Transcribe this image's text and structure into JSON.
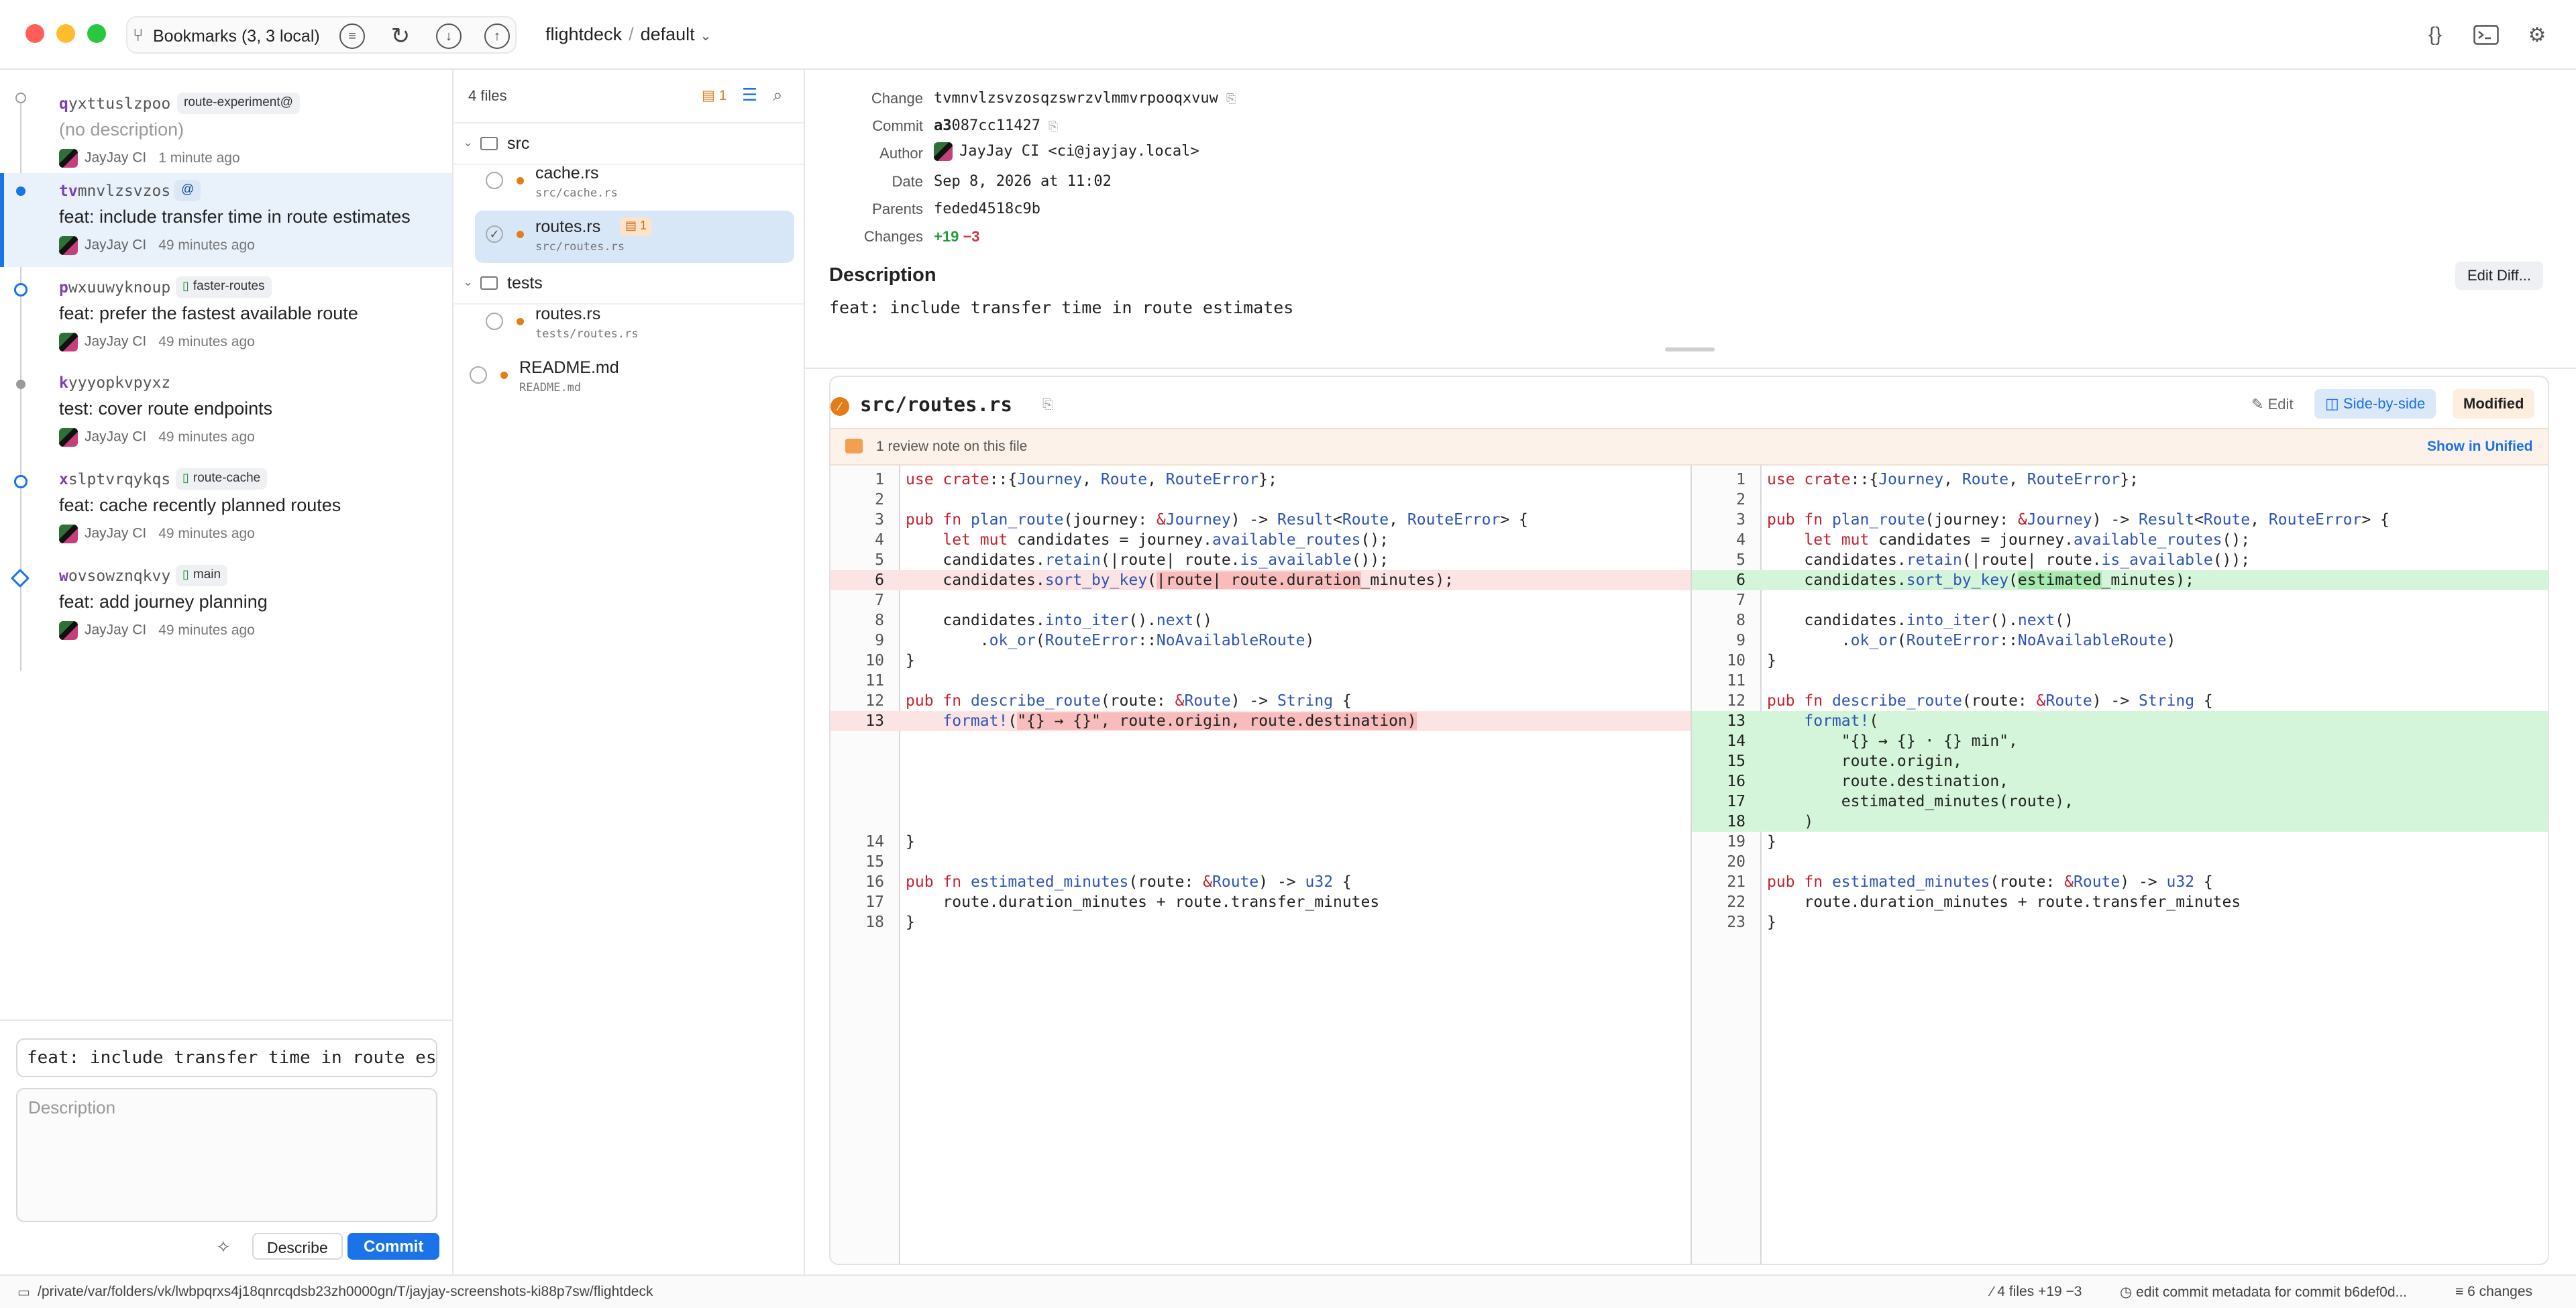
{
  "toolbar": {
    "bookmarks_label": "Bookmarks (3, 3 local)",
    "repo_name": "flightdeck",
    "workspace": "default"
  },
  "changes": [
    {
      "id_prefix": "q",
      "id_rest": "yxttuslzpoo",
      "tags": [
        "route-experiment@"
      ],
      "description": "(no description)",
      "author": "JayJay CI",
      "time": "1 minute ago"
    },
    {
      "id_prefix": "tv",
      "id_rest": "mnvlzsvzos",
      "tags": [
        "@"
      ],
      "description": "feat: include transfer time in route estimates",
      "author": "JayJay CI",
      "time": "49 minutes ago"
    },
    {
      "id_prefix": "p",
      "id_rest": "wxuuwyknoup",
      "tags": [
        "faster-routes"
      ],
      "description": "feat: prefer the fastest available route",
      "author": "JayJay CI",
      "time": "49 minutes ago"
    },
    {
      "id_prefix": "k",
      "id_rest": "yyyopkvpyxz",
      "tags": [],
      "description": "test: cover route endpoints",
      "author": "JayJay CI",
      "time": "49 minutes ago"
    },
    {
      "id_prefix": "x",
      "id_rest": "slptvrqykqs",
      "tags": [
        "route-cache"
      ],
      "description": "feat: cache recently planned routes",
      "author": "JayJay CI",
      "time": "49 minutes ago"
    },
    {
      "id_prefix": "w",
      "id_rest": "ovsowznqkvy",
      "tags": [
        "main"
      ],
      "description": "feat: add journey planning",
      "author": "JayJay CI",
      "time": "49 minutes ago"
    }
  ],
  "commit_box": {
    "title_value": "feat: include transfer time in route estimates",
    "description_placeholder": "Description",
    "describe_label": "Describe",
    "commit_label": "Commit"
  },
  "files": {
    "count_label": "4 files",
    "notes_count": "1",
    "folders": [
      "src",
      "tests"
    ],
    "items": [
      {
        "name": "cache.rs",
        "path": "src/cache.rs",
        "note": ""
      },
      {
        "name": "routes.rs",
        "path": "src/routes.rs",
        "note": "1"
      },
      {
        "name": "routes.rs",
        "path": "tests/routes.rs",
        "note": ""
      },
      {
        "name": "README.md",
        "path": "README.md",
        "note": ""
      }
    ]
  },
  "detail": {
    "change_label": "Change",
    "change_value": "tvmnvlzsvzosqzswrzvlmmvrpooqxvuw",
    "commit_label": "Commit",
    "commit_prefix": "a3",
    "commit_rest": "087cc11427",
    "author_label": "Author",
    "author_value": "JayJay CI <ci@jayjay.local>",
    "date_label": "Date",
    "date_value": "Sep 8, 2026 at 11:02",
    "parents_label": "Parents",
    "parents_value": "feded4518c9b",
    "changes_label": "Changes",
    "additions": "+19",
    "deletions": "−3",
    "description_heading": "Description",
    "description_text": "feat: include transfer time in route estimates",
    "edit_diff_label": "Edit Diff..."
  },
  "diff": {
    "file": "src/routes.rs",
    "edit_label": "Edit",
    "view_mode": "Side-by-side",
    "status": "Modified",
    "notice": "1 review note on this file",
    "show_unified": "Show in Unified",
    "left_numbers": [
      "1",
      "2",
      "3",
      "4",
      "5",
      "6",
      "7",
      "8",
      "9",
      "10",
      "11",
      "12",
      "13",
      "14",
      "15",
      "16",
      "17",
      "18"
    ],
    "right_numbers": [
      "1",
      "2",
      "3",
      "4",
      "5",
      "6",
      "7",
      "8",
      "9",
      "10",
      "11",
      "12",
      "13",
      "14",
      "15",
      "16",
      "17",
      "18",
      "19",
      "20",
      "21",
      "22",
      "23"
    ]
  },
  "statusbar": {
    "path": "/private/var/folders/vk/lwbpqrxs4j18qnrcqdsb23zh0000gn/T/jayjay-screenshots-ki88p7sw/flightdeck",
    "files_summary": "4 files +19 −3",
    "operation": "edit commit metadata for commit b6def0d...",
    "changes_summary": "6 changes"
  },
  "icons": {
    "bookmarks": "branch-icon",
    "toolbar_buttons": [
      "list-icon",
      "sync-icon",
      "fetch-icon",
      "push-icon"
    ],
    "right_buttons": [
      "json-icon",
      "terminal-icon",
      "gear-icon"
    ]
  },
  "colors": {
    "accent": "#1a73e8",
    "deletion_bg": "#fde4e4",
    "addition_bg": "#d4f5d9",
    "modified": "#e57d16"
  }
}
